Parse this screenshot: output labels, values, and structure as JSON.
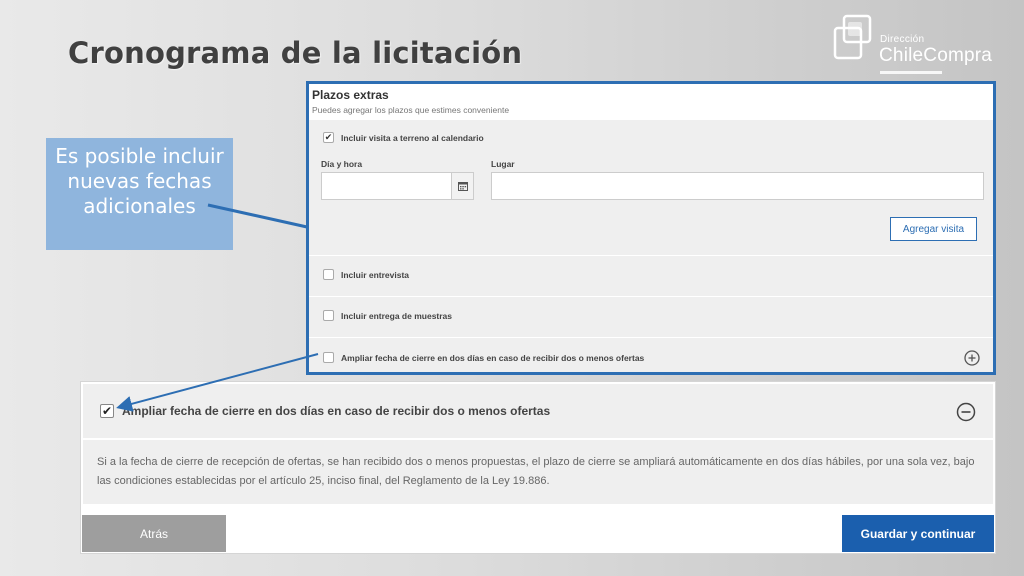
{
  "slide": {
    "title": "Cronograma de la licitación"
  },
  "logo": {
    "small_text": "Dirección",
    "big_text": "ChileCompra"
  },
  "callout": {
    "text": "Es posible incluir nuevas fechas adicionales"
  },
  "plazos": {
    "title": "Plazos extras",
    "subtitle": "Puedes agregar los plazos que estimes conveniente",
    "visita": {
      "label": "Incluir visita a terreno al calendario",
      "checked": true,
      "dia_hora_label": "Día y hora",
      "dia_hora_value": "",
      "lugar_label": "Lugar",
      "lugar_value": "",
      "button_label": "Agregar visita"
    },
    "entrevista": {
      "label": "Incluir entrevista",
      "checked": false
    },
    "muestras": {
      "label": "Incluir entrega de muestras",
      "checked": false
    },
    "ampliar": {
      "label": "Ampliar fecha de cierre en dos días en caso de recibir dos o menos ofertas",
      "checked": false
    }
  },
  "detail": {
    "title": "Ampliar fecha de cierre en dos días en caso de recibir dos o menos ofertas",
    "checked": true,
    "body": "Si a la fecha de cierre de recepción de ofertas, se han recibido dos o menos propuestas, el plazo de cierre se ampliará automáticamente en dos días hábiles, por una sola vez, bajo las condiciones establecidas por el artículo 25, inciso final, del Reglamento de la Ley 19.886."
  },
  "nav": {
    "back_label": "Atrás",
    "save_label": "Guardar y continuar"
  },
  "colors": {
    "accent": "#2d6eb3",
    "primary_button": "#1b5fae",
    "secondary_button": "#9e9e9e",
    "callout": "#8fb5dd"
  },
  "icons": {
    "calendar": "calendar-icon",
    "expand": "plus-circle-icon",
    "collapse": "minus-circle-icon",
    "check": "checkmark-icon"
  }
}
